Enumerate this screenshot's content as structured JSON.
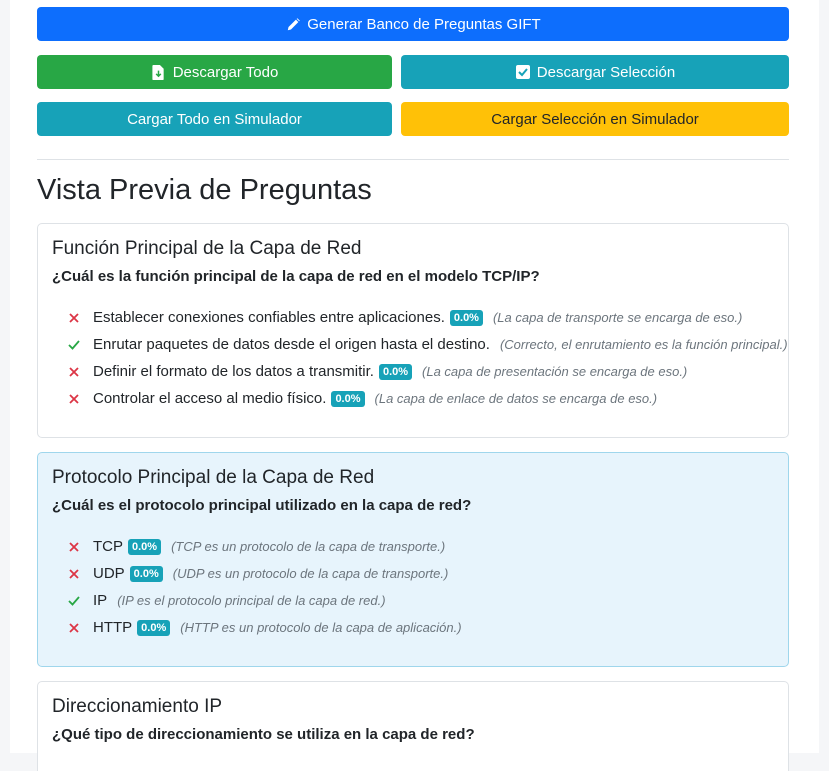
{
  "buttons": {
    "generate": "Generar Banco de Preguntas GIFT",
    "download_all": "Descargar Todo",
    "download_selection": "Descargar Selección",
    "load_all": "Cargar Todo en Simulador",
    "load_selection": "Cargar Selección en Simulador"
  },
  "icons": {
    "generate": "pencil-icon",
    "download_all": "file-download-icon",
    "download_selection": "check-square-icon",
    "correct": "check-icon",
    "incorrect": "x-icon"
  },
  "colors": {
    "primary": "#0d6efd",
    "success": "#28a745",
    "info": "#17a2b8",
    "warning": "#ffc107",
    "incorrect_mark": "#dc3545",
    "correct_mark": "#28a745"
  },
  "preview": {
    "title": "Vista Previa de Preguntas",
    "questions": [
      {
        "title": "Función Principal de la Capa de Red",
        "question": "¿Cuál es la función principal de la capa de red en el modelo TCP/IP?",
        "options": [
          {
            "text": "Establecer conexiones confiables entre aplicaciones.",
            "correct": false,
            "badge": "0.0%",
            "feedback": "(La capa de transporte se encarga de eso.)"
          },
          {
            "text": "Enrutar paquetes de datos desde el origen hasta el destino.",
            "correct": true,
            "badge": "",
            "feedback": "(Correcto, el enrutamiento es la función principal.)"
          },
          {
            "text": "Definir el formato de los datos a transmitir.",
            "correct": false,
            "badge": "0.0%",
            "feedback": "(La capa de presentación se encarga de eso.)"
          },
          {
            "text": "Controlar el acceso al medio físico.",
            "correct": false,
            "badge": "0.0%",
            "feedback": "(La capa de enlace de datos se encarga de eso.)"
          }
        ]
      },
      {
        "title": "Protocolo Principal de la Capa de Red",
        "question": "¿Cuál es el protocolo principal utilizado en la capa de red?",
        "options": [
          {
            "text": "TCP",
            "correct": false,
            "badge": "0.0%",
            "feedback": "(TCP es un protocolo de la capa de transporte.)"
          },
          {
            "text": "UDP",
            "correct": false,
            "badge": "0.0%",
            "feedback": "(UDP es un protocolo de la capa de transporte.)"
          },
          {
            "text": "IP",
            "correct": true,
            "badge": "",
            "feedback": "(IP es el protocolo principal de la capa de red.)"
          },
          {
            "text": "HTTP",
            "correct": false,
            "badge": "0.0%",
            "feedback": "(HTTP es un protocolo de la capa de aplicación.)"
          }
        ]
      },
      {
        "title": "Direccionamiento IP",
        "question": "¿Qué tipo de direccionamiento se utiliza en la capa de red?",
        "options": []
      }
    ]
  }
}
